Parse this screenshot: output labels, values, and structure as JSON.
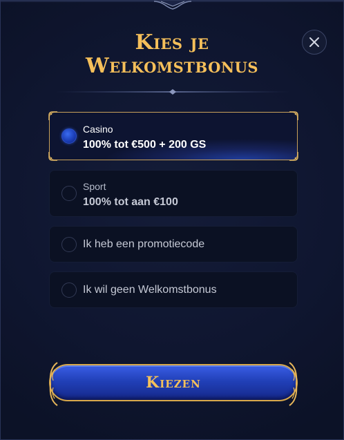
{
  "title": {
    "line1": "Kies je",
    "line2": "Welkomstbonus"
  },
  "options": [
    {
      "label_small": "Casino",
      "label_main": "100% tot €500 + 200 GS",
      "selected": true
    },
    {
      "label_small": "Sport",
      "label_main": "100% tot aan €100",
      "selected": false
    },
    {
      "label": "Ik heb een promotiecode",
      "selected": false
    },
    {
      "label": "Ik wil geen Welkomstbonus",
      "selected": false
    }
  ],
  "cta": {
    "label": "Kiezen"
  },
  "icons": {
    "close": "close-icon",
    "radio": "radio-icon"
  },
  "colors": {
    "gold": "#f5bf5a",
    "accent_blue": "#2140b8",
    "background": "#0e1428"
  }
}
